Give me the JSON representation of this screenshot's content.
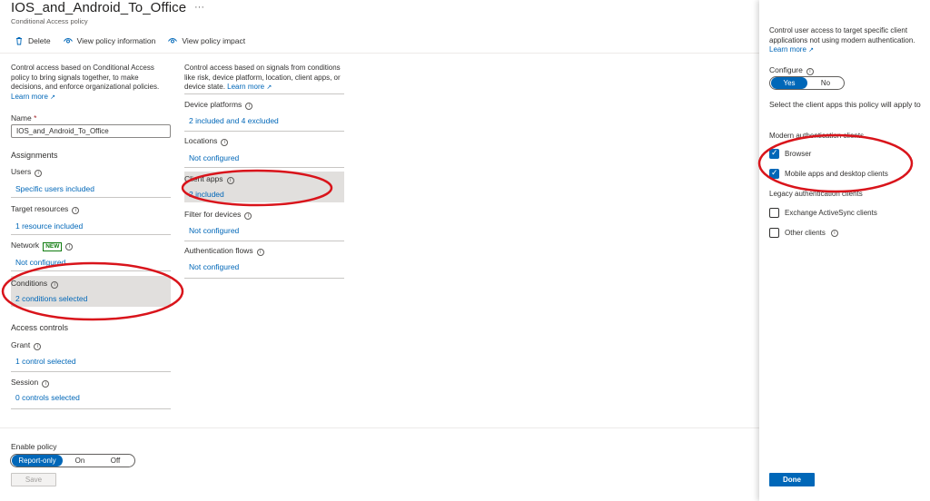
{
  "header": {
    "title": "IOS_and_Android_To_Office",
    "ellipsis": "···",
    "subtitle": "Conditional Access policy"
  },
  "toolbar": {
    "delete_label": "Delete",
    "view_info_label": "View policy information",
    "view_impact_label": "View policy impact"
  },
  "left": {
    "description": "Control access based on Conditional Access policy to bring signals together, to make decisions, and enforce organizational policies.",
    "learn_more": "Learn more",
    "name_label": "Name",
    "name_required": "*",
    "name_value": "IOS_and_Android_To_Office",
    "assignments_heading": "Assignments",
    "users_label": "Users",
    "users_value": "Specific users included",
    "target_label": "Target resources",
    "target_value": "1 resource included",
    "network_label": "Network",
    "network_badge": "NEW",
    "network_value": "Not configured",
    "conditions_label": "Conditions",
    "conditions_value": "2 conditions selected",
    "access_controls_heading": "Access controls",
    "grant_label": "Grant",
    "grant_value": "1 control selected",
    "session_label": "Session",
    "session_value": "0 controls selected"
  },
  "middle": {
    "description": "Control access based on signals from conditions like risk, device platform, location, client apps, or device state.",
    "learn_more": "Learn more",
    "device_platforms_label": "Device platforms",
    "device_platforms_value": "2 included and 4 excluded",
    "locations_label": "Locations",
    "locations_value": "Not configured",
    "client_apps_label": "Client apps",
    "client_apps_value": "2 included",
    "filter_devices_label": "Filter for devices",
    "filter_devices_value": "Not configured",
    "auth_flows_label": "Authentication flows",
    "auth_flows_value": "Not configured"
  },
  "footer": {
    "enable_label": "Enable policy",
    "opt_report": "Report-only",
    "opt_on": "On",
    "opt_off": "Off",
    "selected": "Report-only",
    "save_label": "Save"
  },
  "panel": {
    "description": "Control user access to target specific client applications not using modern authentication.",
    "learn_more": "Learn more",
    "configure_label": "Configure",
    "yes": "Yes",
    "no": "No",
    "configure_selected": "Yes",
    "select_text": "Select the client apps this policy will apply to",
    "modern_group": "Modern authentication clients",
    "browser_label": "Browser",
    "browser_checked": true,
    "mobile_label": "Mobile apps and desktop clients",
    "mobile_checked": true,
    "legacy_group": "Legacy authentication clients",
    "eas_label": "Exchange ActiveSync clients",
    "eas_checked": false,
    "other_label": "Other clients",
    "other_checked": false,
    "done_label": "Done"
  },
  "colors": {
    "accent": "#0067b8",
    "highlight_row": "#e1dfdd",
    "annotation": "#d9141b",
    "new_badge": "#107c10"
  }
}
